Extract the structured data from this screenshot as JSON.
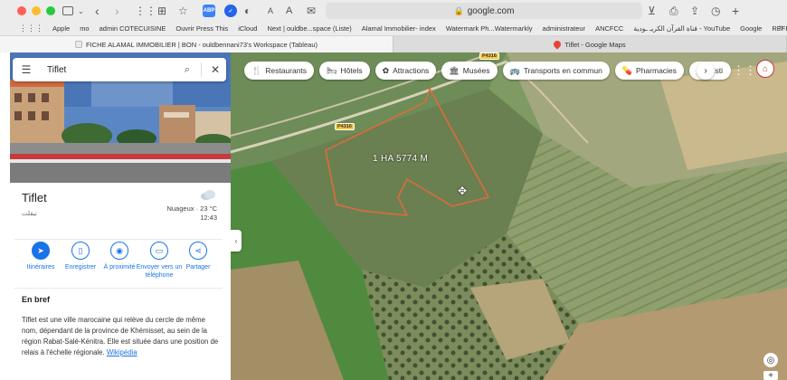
{
  "browser": {
    "url": "google.com",
    "bookmarks": [
      "Apple",
      "mo",
      "admin COTECUISINE",
      "Ouvrir Press This",
      "iCloud",
      "Next | ouldbe...space (Liste)",
      "Alamal Immobilier- index",
      "Watermark Ph...Watermarkly",
      "administrateur",
      "ANCFCC",
      "قناة القرآن الكريـ ـودية - YouTube",
      "Google",
      "REFERENTIEL"
    ],
    "tabs": [
      {
        "label": "FICHE ALAMAL IMMOBILIER | BON - ouldbennani73's Workspace (Tableau)",
        "active": true
      },
      {
        "label": "Tiflet - Google Maps",
        "active": false
      }
    ],
    "toolbar_badges": {
      "abp": "ABP",
      "abp_color": "#3b82f6"
    }
  },
  "search": {
    "query": "Tiflet"
  },
  "place": {
    "name": "Tiflet",
    "name_arabic": "تيفلت",
    "weather": {
      "condition": "Nuageux · 23 °C",
      "time": "12:43",
      "icon": "cloud-icon"
    }
  },
  "actions": [
    {
      "label": "Itinéraires",
      "icon": "directions-icon"
    },
    {
      "label": "Enregistrer",
      "icon": "bookmark-icon"
    },
    {
      "label": "À proximité",
      "icon": "nearby-icon"
    },
    {
      "label": "Envoyer vers un téléphone",
      "icon": "send-to-phone-icon"
    },
    {
      "label": "Partager",
      "icon": "share-icon"
    }
  ],
  "overview": {
    "heading": "En bref",
    "text": "Tiflet est une ville marocaine qui relève du cercle de même nom, dépendant de la province de Khémisset, au sein de la région Rabat-Salé-Kénitra. Elle est située dans une position de relais à l'échelle régionale.",
    "link": "Wikipédia"
  },
  "map": {
    "chips": [
      {
        "label": "Restaurants",
        "icon": "restaurant-icon"
      },
      {
        "label": "Hôtels",
        "icon": "hotel-icon"
      },
      {
        "label": "Attractions",
        "icon": "attractions-icon"
      },
      {
        "label": "Musées",
        "icon": "museum-icon"
      },
      {
        "label": "Transports en commun",
        "icon": "transit-icon"
      },
      {
        "label": "Pharmacies",
        "icon": "pharmacy-icon"
      },
      {
        "label": "Disti",
        "icon": "atm-icon"
      }
    ],
    "area_label": "1 HA 5774 M",
    "road_labels": [
      "P4316",
      "P4316"
    ],
    "colors": {
      "boundary": "#e36a3c",
      "accent": "#1a73e8"
    }
  }
}
